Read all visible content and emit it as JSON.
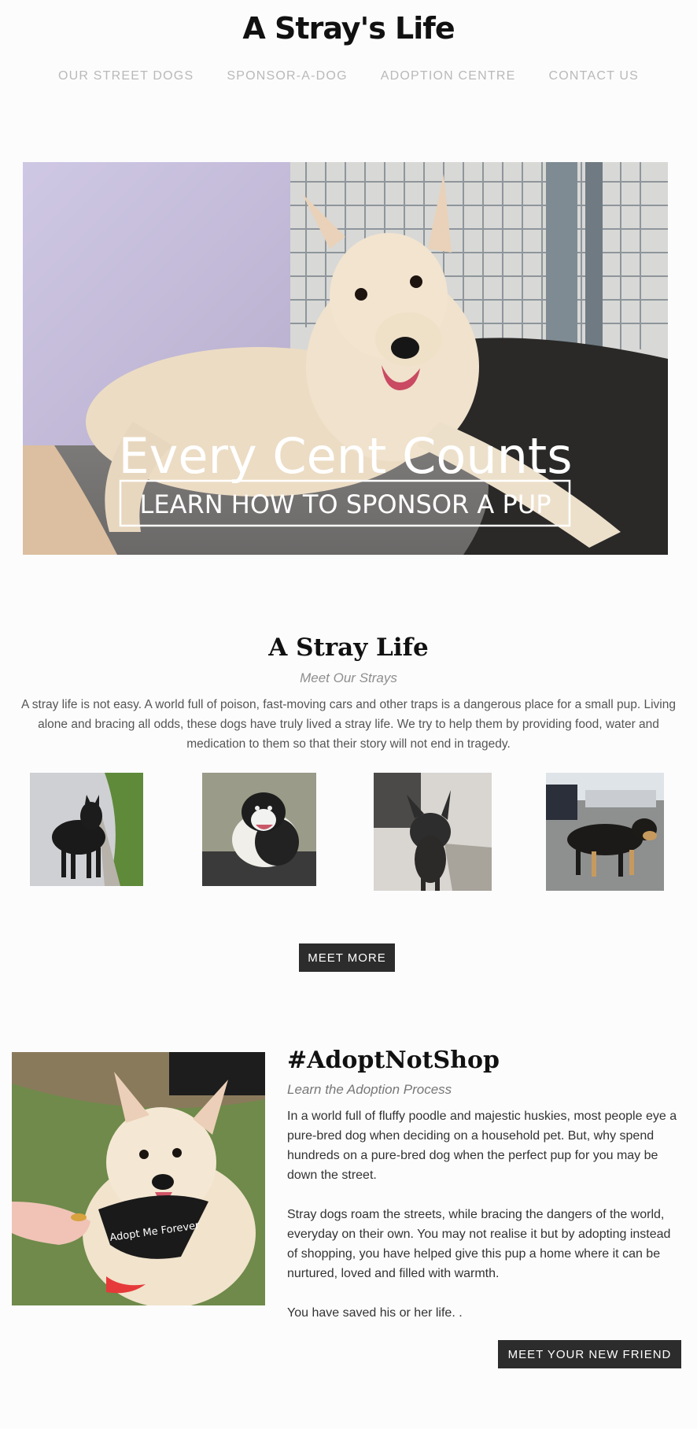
{
  "header": {
    "site_title": "A Stray's Life",
    "nav": [
      "OUR STREET DOGS",
      "SPONSOR-A-DOG",
      "ADOPTION CENTRE",
      "CONTACT US"
    ]
  },
  "hero": {
    "headline": "Every Cent Counts",
    "cta": "LEARN HOW TO SPONSOR A PUP"
  },
  "stray_section": {
    "title": "A Stray Life",
    "subtitle": "Meet Our Strays",
    "body": "A stray life is not easy. A world full of poison, fast-moving cars and other traps is a dangerous place for a small pup. Living alone and bracing all odds, these dogs have truly lived a stray life. We try to help them by providing food, water and medication to them so that their story will not end in tragedy.",
    "button": "MEET MORE"
  },
  "adopt_section": {
    "title": "#AdoptNotShop",
    "subtitle": "Learn the Adoption Process",
    "paragraphs": [
      "In a world full of fluffy poodle and majestic huskies, most people eye a pure-bred dog when deciding on a household pet. But, why spend hundreds on a pure-bred dog when the perfect pup for you may be down the street.",
      "Stray dogs roam the streets, while bracing the dangers of the world, everyday on their own. You may not realise it but by adopting instead of shopping, you have helped give this pup a home where it can be nurtured, loved and filled with warmth.",
      "You have saved his or her life. ."
    ],
    "button": "MEET YOUR NEW FRIEND",
    "bandana_text": "Adopt Me Forever"
  },
  "colors": {
    "button_bg": "#2c2c2c",
    "nav_text": "#b9b9b9",
    "heading": "#111111"
  }
}
